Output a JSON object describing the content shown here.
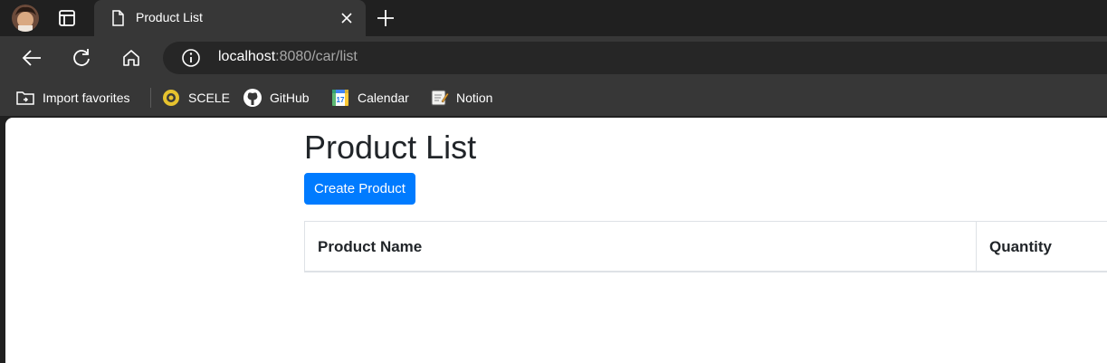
{
  "browser": {
    "tab": {
      "title": "Product List"
    },
    "address_bar": {
      "host": "localhost",
      "rest": ":8080/car/list"
    },
    "bookmarks": [
      {
        "label": "Import favorites",
        "icon": "import-favorites-icon"
      },
      {
        "label": "SCELE",
        "icon": "scele-icon"
      },
      {
        "label": "GitHub",
        "icon": "github-icon"
      },
      {
        "label": "Calendar",
        "icon": "calendar-icon"
      },
      {
        "label": "Notion",
        "icon": "notion-icon"
      }
    ],
    "calendar_icon_day": "17"
  },
  "page": {
    "title": "Product List",
    "create_button": "Create Product",
    "table": {
      "headers": [
        "Product Name",
        "Quantity"
      ],
      "rows": []
    }
  },
  "colors": {
    "primary_button": "#007bff",
    "browser_dark": "#202020",
    "toolbar": "#373737"
  }
}
